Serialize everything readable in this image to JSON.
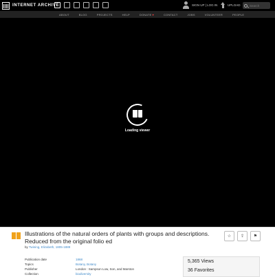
{
  "header": {
    "logo_text": "INTERNET ARCHIVE",
    "media_icons": [
      "web-icon",
      "texts-icon",
      "video-icon",
      "audio-icon",
      "software-icon",
      "images-icon"
    ],
    "user_links": "SIGN UP | LOG IN",
    "upload_label": "UPLOAD",
    "search_placeholder": "Search"
  },
  "nav": {
    "items": [
      "ABOUT",
      "BLOG",
      "PROJECTS",
      "HELP",
      "DONATE",
      "CONTACT",
      "JOBS",
      "VOLUNTEER",
      "PEOPLE"
    ],
    "donate_heart": "♥"
  },
  "viewer": {
    "loading_text": "Loading viewer"
  },
  "item": {
    "title": "Illustrations of the natural orders of plants with groups and descriptions. Reduced from the original folio ed",
    "by_prefix": "by",
    "author": "Twining, Elizabeth, 1805-1889",
    "actions": {
      "favorite": "☆",
      "share": "⇪",
      "flag": "⚑"
    },
    "metadata": [
      {
        "key": "Publication date",
        "value": "1868",
        "link": true
      },
      {
        "key": "Topics",
        "value": "Botany, Botany",
        "link": true
      },
      {
        "key": "Publisher",
        "value": "London : Sampson Low, Son, and Marston",
        "link": false
      },
      {
        "key": "Collection",
        "value": "biodiversity",
        "link": true
      }
    ],
    "stats": {
      "views": "5,365 Views",
      "favorites": "36 Favorites"
    }
  },
  "colors": {
    "accent": "#428bca",
    "texts_icon": "#f0a21b",
    "donate_heart": "#ee4444"
  }
}
